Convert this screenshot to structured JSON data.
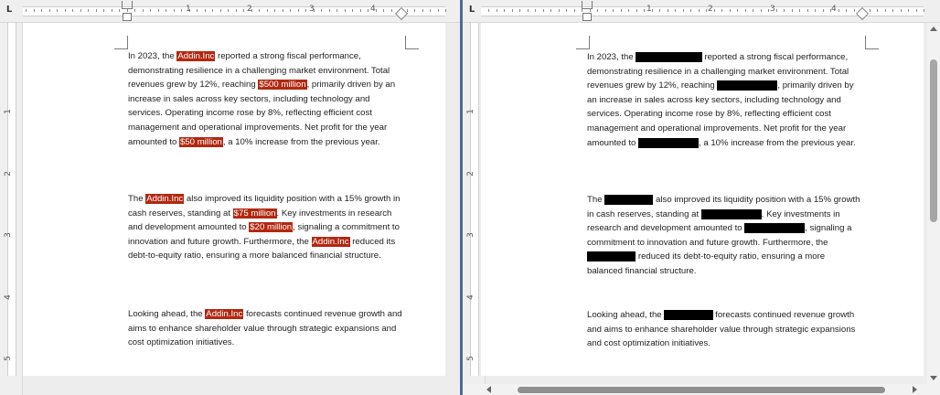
{
  "ruler": {
    "numbers": [
      "1",
      "2",
      "3",
      "4"
    ],
    "vertical_numbers": [
      "1",
      "2",
      "3",
      "4",
      "5"
    ],
    "tab_selector": "L"
  },
  "left_doc": {
    "p1": {
      "s1": "In 2023, the ",
      "h1": "Addin.Inc",
      "s2": " reported a strong fiscal performance, demonstrating resilience in a challenging market environment. Total revenues grew by 12%, reaching ",
      "h2": "$500 million",
      "s3": ", primarily driven by an increase in sales across key sectors, including technology and services. Operating income rose by 8%, reflecting efficient cost management and operational improvements. Net profit for the year amounted to ",
      "h3": "$50 million",
      "s4": ", a 10% increase from the previous year."
    },
    "p2": {
      "s1": "The ",
      "h1": "Addin.Inc",
      "s2": " also improved its liquidity position with a 15% growth in cash reserves, standing at ",
      "h2": "$75 million",
      "s3": ". Key investments in research and development amounted to ",
      "h3": "$20 million",
      "s4": ", signaling a commitment to innovation and future growth. Furthermore, the ",
      "h4": "Addin.Inc",
      "s5": " reduced its debt-to-equity ratio, ensuring a more balanced financial structure."
    },
    "p3": {
      "s1": "Looking ahead, the ",
      "h1": "Addin.Inc",
      "s2": " forecasts continued revenue growth and aims to enhance shareholder value through strategic expansions and cost optimization initiatives."
    }
  },
  "right_doc": {
    "p1": {
      "s1": "In 2023, the ",
      "s2": " reported a strong fiscal performance, demonstrating resilience in a challenging market environment. Total revenues grew by 12%, reaching ",
      "s3": ", primarily driven by an increase in sales across key sectors, including technology and services. Operating income rose by 8%, reflecting efficient cost management and operational improvements. Net profit for the year amounted to ",
      "s4": ", a 10% increase from the previous year."
    },
    "p2": {
      "s1": "The ",
      "s2": " also improved its liquidity position with a 15% growth in cash reserves, standing at ",
      "s3": ". Key investments in research and development amounted to ",
      "s4": ", signaling a commitment to innovation and future growth. Furthermore, the ",
      "s5": " reduced its debt-to-equity ratio, ensuring a more balanced financial structure."
    },
    "p3": {
      "s1": "Looking ahead, the ",
      "s2": " forecasts continued revenue growth and aims to enhance shareholder value through strategic expansions and cost optimization initiatives."
    },
    "redaction_color": "#000000"
  },
  "colors": {
    "highlight": "#b22810",
    "pane_divider": "#4b6a9a"
  }
}
